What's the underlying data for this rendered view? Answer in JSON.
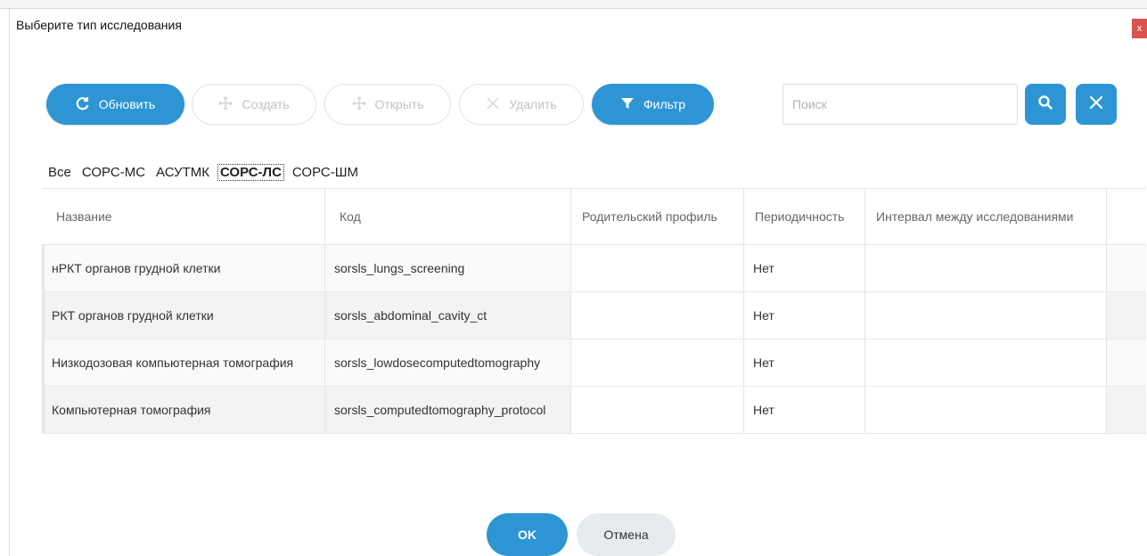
{
  "dialog": {
    "title": "Выберите тип исследования",
    "close_glyph": "x"
  },
  "toolbar": {
    "refresh": {
      "label": "Обновить",
      "icon": "refresh-icon",
      "enabled": true
    },
    "create": {
      "label": "Создать",
      "icon": "move-arrows-icon",
      "enabled": false
    },
    "open": {
      "label": "Открыть",
      "icon": "move-arrows-icon",
      "enabled": false
    },
    "delete": {
      "label": "Удалить",
      "icon": "close-icon",
      "enabled": false
    },
    "filter": {
      "label": "Фильтр",
      "icon": "funnel-icon",
      "enabled": true
    }
  },
  "search": {
    "placeholder": "Поиск",
    "value": "",
    "search_icon": "search-icon",
    "clear_icon": "close-icon"
  },
  "filter_tabs": [
    {
      "label": "Все",
      "active": false
    },
    {
      "label": "СОРС-МС",
      "active": false
    },
    {
      "label": "АСУТМК",
      "active": false
    },
    {
      "label": "СОРС-ЛС",
      "active": true
    },
    {
      "label": "СОРС-ШМ",
      "active": false
    }
  ],
  "grid": {
    "columns": [
      "Название",
      "Код",
      "Родительский профиль",
      "Периодичность",
      "Интервал между исследованиями",
      ""
    ],
    "rows": [
      [
        "нРКТ органов грудной клетки",
        "sorsls_lungs_screening",
        "",
        "Нет",
        ""
      ],
      [
        "РКТ органов грудной клетки",
        "sorsls_abdominal_cavity_ct",
        "",
        "Нет",
        ""
      ],
      [
        "Низкодозовая компьютерная томография",
        "sorsls_lowdosecomputedtomography",
        "",
        "Нет",
        ""
      ],
      [
        "Компьютерная томография",
        "sorsls_computedtomography_protocol",
        "",
        "Нет",
        ""
      ]
    ]
  },
  "footer": {
    "ok_label": "OK",
    "cancel_label": "Отмена"
  },
  "colors": {
    "accent": "#2d95d4",
    "close": "#d9534f",
    "disabled_text": "#c2c2c2"
  }
}
